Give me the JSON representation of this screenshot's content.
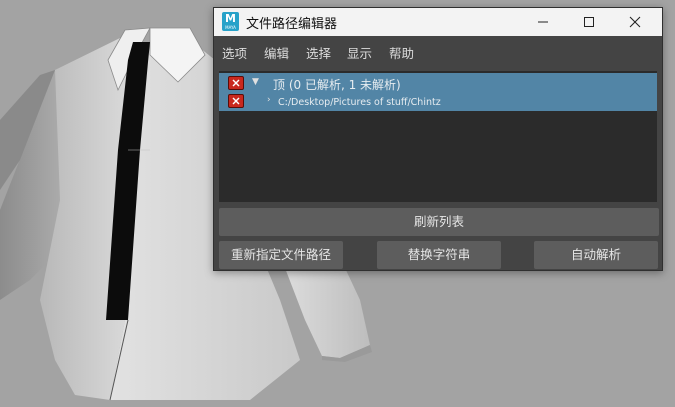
{
  "window": {
    "title": "文件路径编辑器",
    "app_icon_letter": "M",
    "app_icon_sub": "MAYA"
  },
  "menu": {
    "items": [
      "选项",
      "编辑",
      "选择",
      "显示",
      "帮助"
    ]
  },
  "tree": {
    "root_label": "顶 (0 已解析, 1 未解析)",
    "child_path": "C:/Desktop/Pictures of stuff/Chintz",
    "status_icon": "error-x-icon"
  },
  "buttons": {
    "refresh": "刷新列表",
    "retarget": "重新指定文件路径",
    "replace": "替换字符串",
    "auto_resolve": "自动解析"
  },
  "colors": {
    "selection": "#5285a6",
    "dialog_bg": "#444444",
    "list_bg": "#2b2b2b",
    "error_red": "#c8281e",
    "maya_icon": "#27a2c9",
    "viewport_bg": "#a3a3a3"
  }
}
